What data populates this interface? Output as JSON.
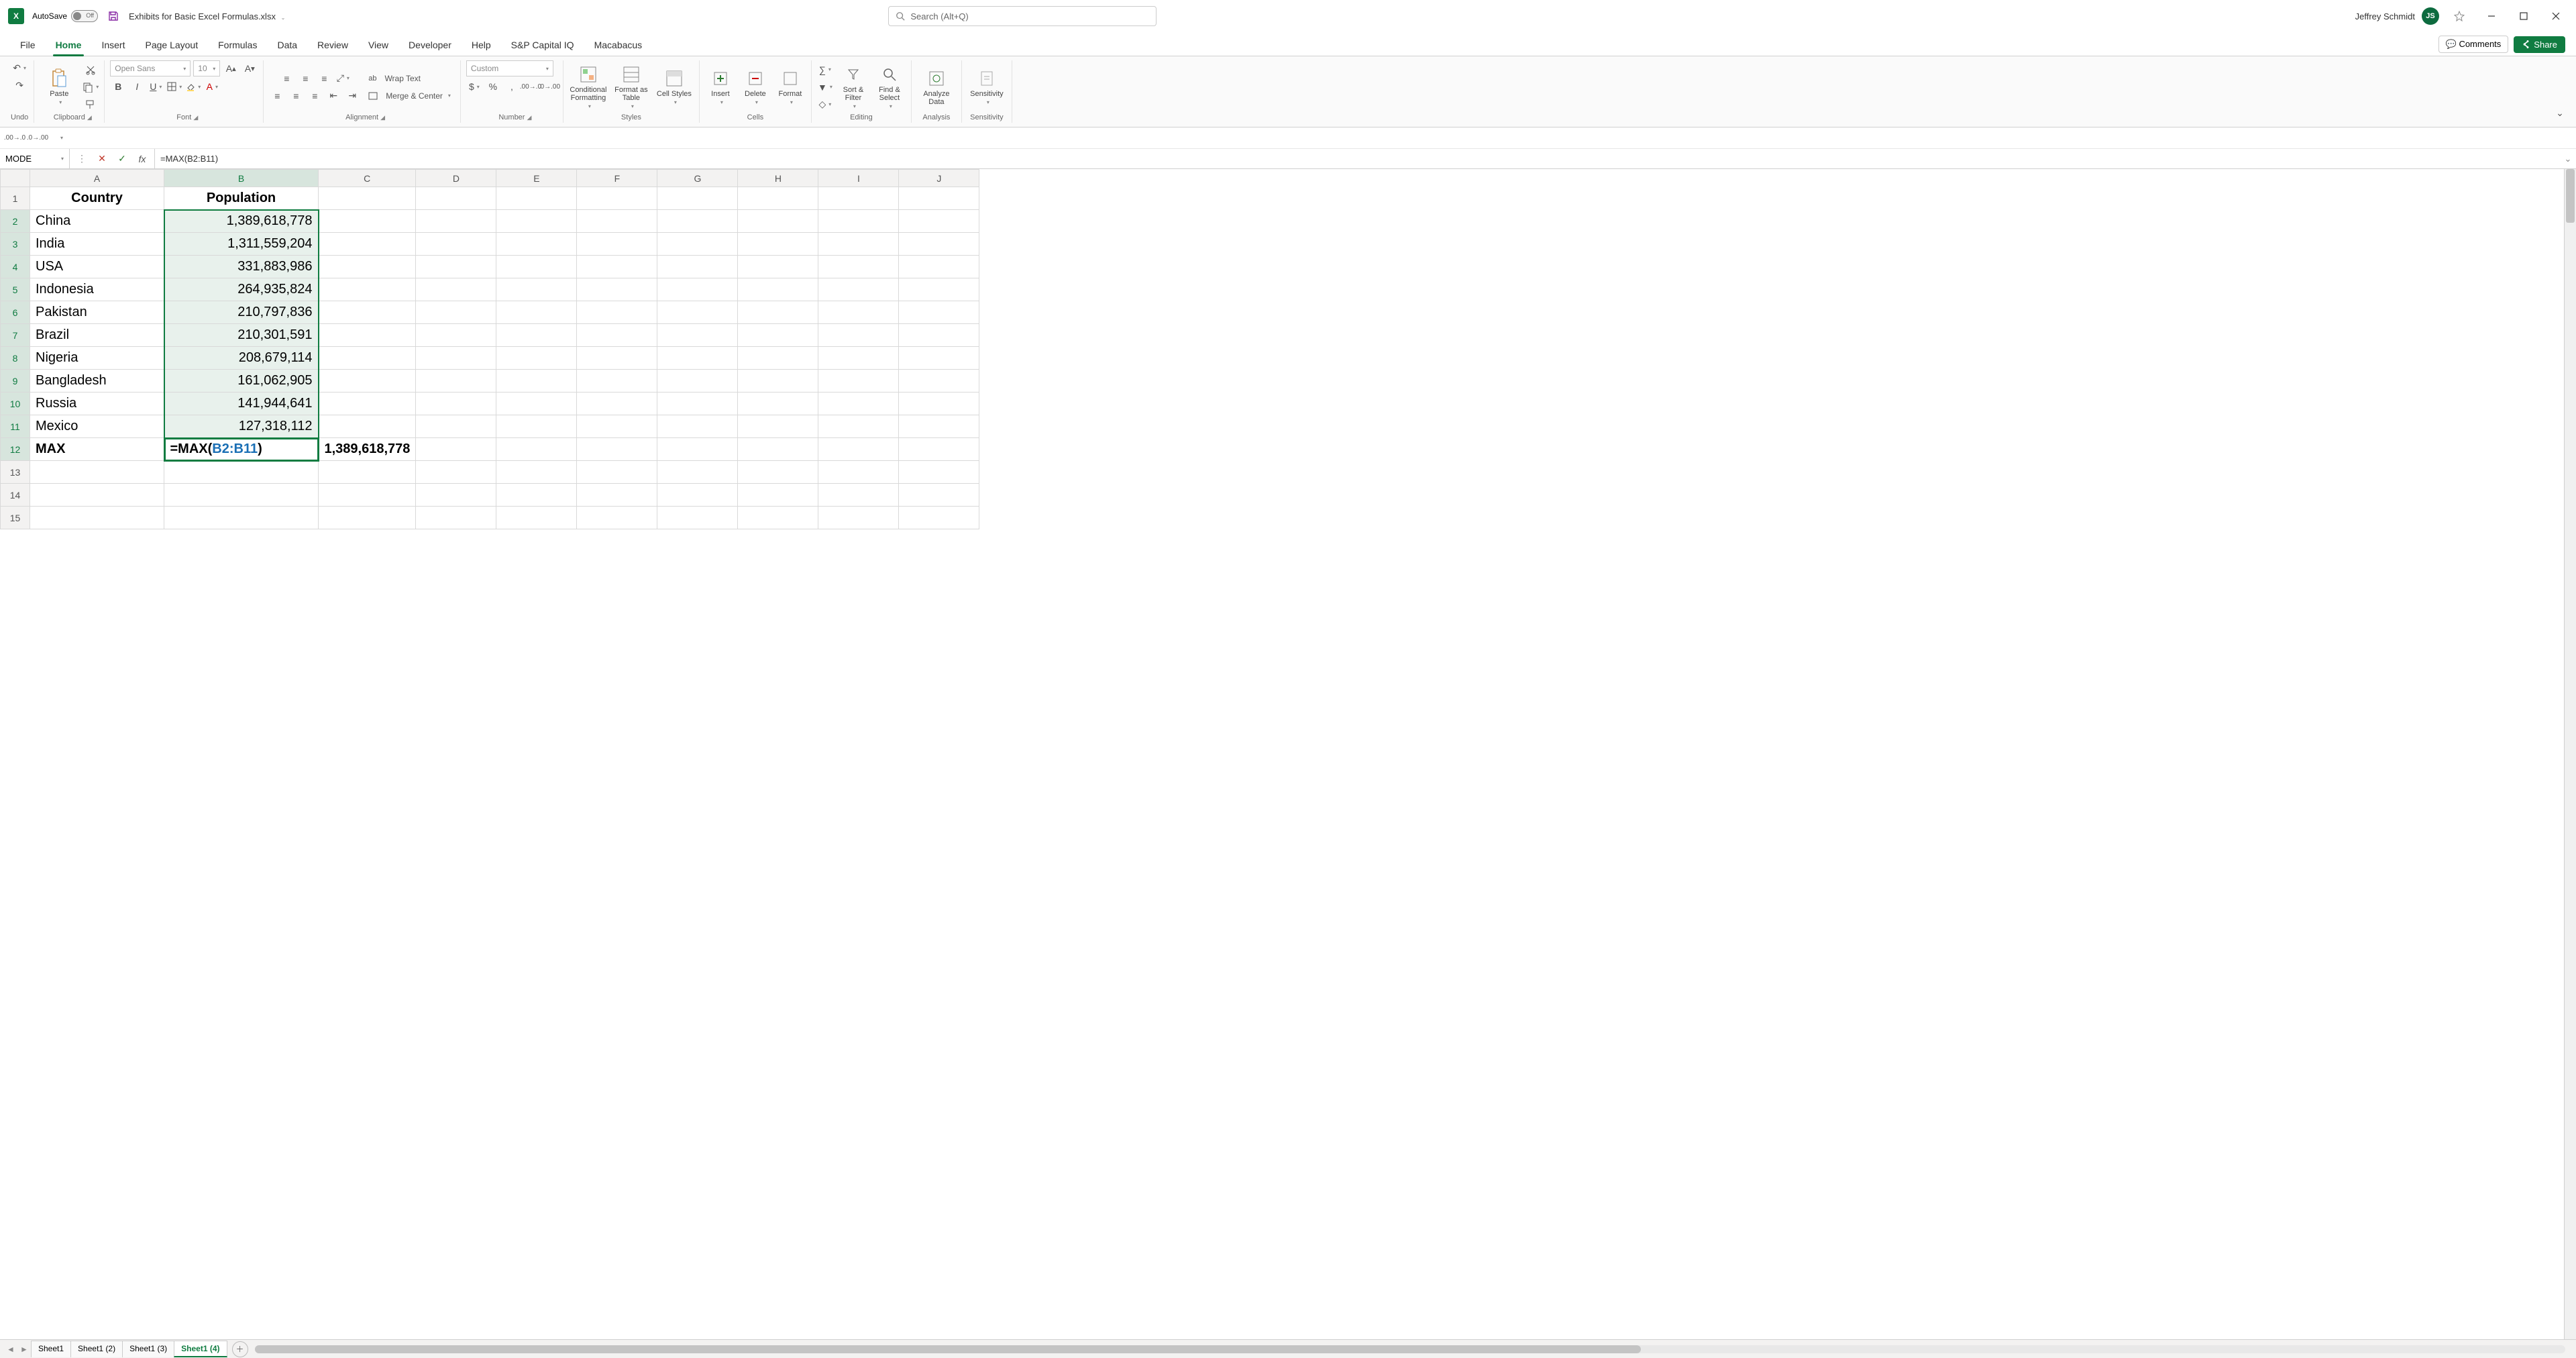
{
  "titlebar": {
    "autosave_label": "AutoSave",
    "autosave_state": "Off",
    "filename": "Exhibits for Basic Excel Formulas.xlsx",
    "search_placeholder": "Search (Alt+Q)",
    "user_name": "Jeffrey Schmidt",
    "user_initials": "JS"
  },
  "ribbon_tabs": [
    "File",
    "Home",
    "Insert",
    "Page Layout",
    "Formulas",
    "Data",
    "Review",
    "View",
    "Developer",
    "Help",
    "S&P Capital IQ",
    "Macabacus"
  ],
  "ribbon_active_tab": "Home",
  "ribbon_right": {
    "comments": "Comments",
    "share": "Share"
  },
  "ribbon": {
    "undo_label": "Undo",
    "clipboard": {
      "paste": "Paste",
      "label": "Clipboard"
    },
    "font": {
      "name": "Open Sans",
      "size": "10",
      "label": "Font"
    },
    "alignment": {
      "wrap": "Wrap Text",
      "merge": "Merge & Center",
      "label": "Alignment"
    },
    "number": {
      "format": "Custom",
      "label": "Number"
    },
    "styles": {
      "cond": "Conditional Formatting",
      "table": "Format as Table",
      "cell": "Cell Styles",
      "label": "Styles"
    },
    "cells": {
      "insert": "Insert",
      "delete": "Delete",
      "format": "Format",
      "label": "Cells"
    },
    "editing": {
      "sort": "Sort & Filter",
      "find": "Find & Select",
      "label": "Editing"
    },
    "analysis": {
      "analyze": "Analyze Data",
      "label": "Analysis"
    },
    "sensitivity": {
      "btn": "Sensitivity",
      "label": "Sensitivity"
    }
  },
  "formula_bar": {
    "name_box": "MODE",
    "fx_text_prefix": "=MAX(",
    "fx_text_blue": "B2:B11",
    "fx_text_suffix": ")"
  },
  "columns": [
    "A",
    "B",
    "C",
    "D",
    "E",
    "F",
    "G",
    "H",
    "I",
    "J"
  ],
  "rows_visible": 15,
  "headers": {
    "A": "Country",
    "B": "Population"
  },
  "data_rows": [
    {
      "country": "China",
      "population": "1,389,618,778"
    },
    {
      "country": "India",
      "population": "1,311,559,204"
    },
    {
      "country": "USA",
      "population": "331,883,986"
    },
    {
      "country": "Indonesia",
      "population": "264,935,824"
    },
    {
      "country": "Pakistan",
      "population": "210,797,836"
    },
    {
      "country": "Brazil",
      "population": "210,301,591"
    },
    {
      "country": "Nigeria",
      "population": "208,679,114"
    },
    {
      "country": "Bangladesh",
      "population": "161,062,905"
    },
    {
      "country": "Russia",
      "population": "141,944,641"
    },
    {
      "country": "Mexico",
      "population": "127,318,112"
    }
  ],
  "formula_row": {
    "label": "MAX",
    "cell_prefix": "=MAX(",
    "cell_blue": "B2:B11",
    "cell_suffix": ")",
    "result": "1,389,618,778"
  },
  "sheet_tabs": [
    "Sheet1",
    "Sheet1 (2)",
    "Sheet1 (3)",
    "Sheet1 (4)"
  ],
  "sheet_active": "Sheet1 (4)"
}
